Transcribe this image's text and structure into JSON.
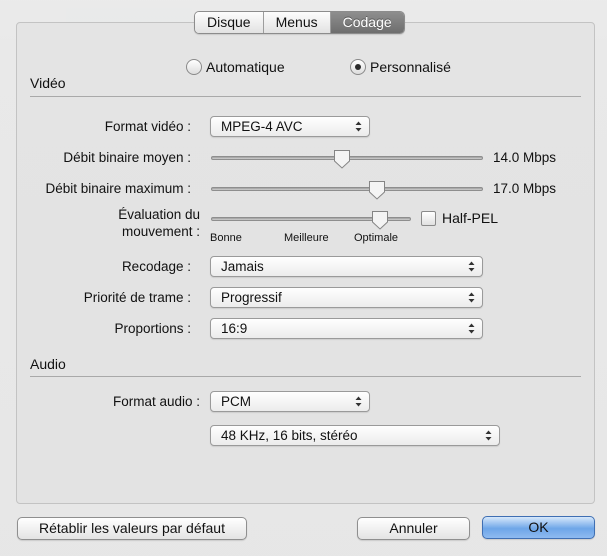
{
  "tabs": [
    {
      "label": "Disque",
      "active": false
    },
    {
      "label": "Menus",
      "active": false
    },
    {
      "label": "Codage",
      "active": true
    }
  ],
  "mode": {
    "automatic_label": "Automatique",
    "custom_label": "Personnalisé",
    "selected": "custom"
  },
  "video": {
    "section_label": "Vidéo",
    "format_label": "Format vidéo :",
    "format_value": "MPEG-4 AVC",
    "avg_bitrate_label": "Débit binaire moyen :",
    "avg_bitrate_value": "14.0 Mbps",
    "avg_bitrate_fraction": 0.48,
    "max_bitrate_label": "Débit binaire maximum :",
    "max_bitrate_value": "17.0 Mbps",
    "max_bitrate_fraction": 0.62,
    "motion_label_line1": "Évaluation du",
    "motion_label_line2": "mouvement :",
    "motion_fraction": 0.88,
    "motion_ticks": [
      "Bonne",
      "Meilleure",
      "Optimale"
    ],
    "halfpel_label": "Half-PEL",
    "halfpel_checked": false,
    "recode_label": "Recodage :",
    "recode_value": "Jamais",
    "frame_priority_label": "Priorité de trame :",
    "frame_priority_value": "Progressif",
    "aspect_label": "Proportions :",
    "aspect_value": "16:9"
  },
  "audio": {
    "section_label": "Audio",
    "format_label": "Format audio :",
    "format_value": "PCM",
    "quality_value": "48 KHz, 16 bits, stéréo"
  },
  "buttons": {
    "reset_label": "Rétablir les valeurs par défaut",
    "cancel_label": "Annuler",
    "ok_label": "OK"
  },
  "colors": {
    "active_tab": "#7d7d7d",
    "default_button": "#6ea6e8"
  }
}
